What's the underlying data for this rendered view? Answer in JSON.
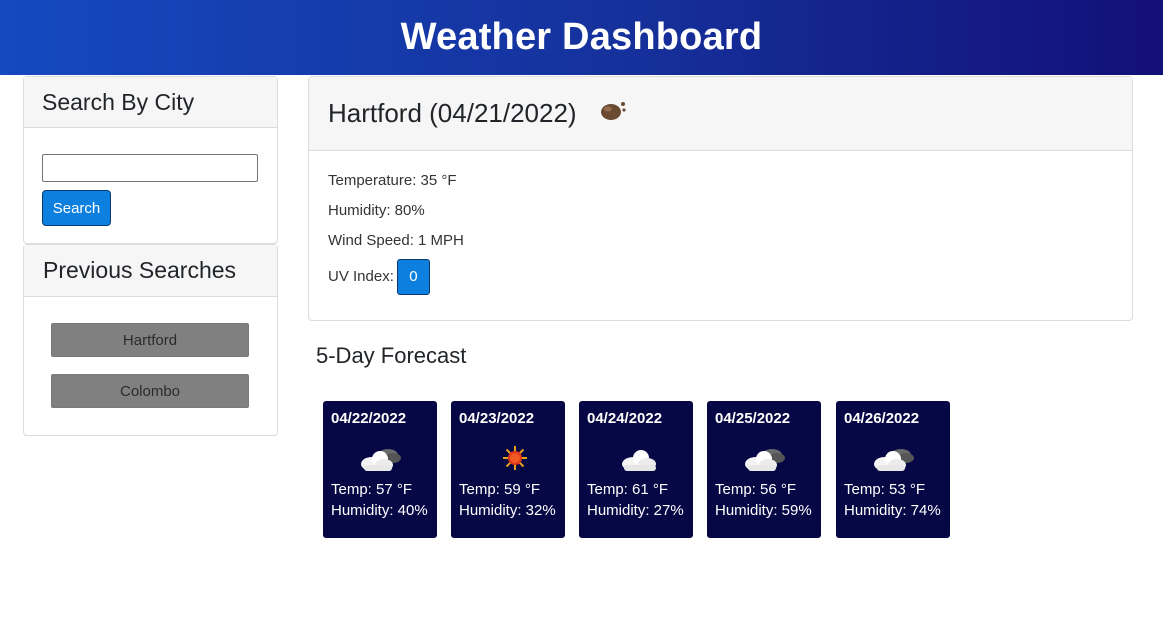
{
  "header": {
    "title": "Weather Dashboard"
  },
  "search": {
    "heading": "Search By City",
    "input_value": "",
    "button_label": "Search"
  },
  "history": {
    "heading": "Previous Searches",
    "items": [
      "Hartford",
      "Colombo"
    ]
  },
  "current": {
    "title": "Hartford (04/21/2022)",
    "icon": "haze-icon",
    "temperature": "Temperature: 35 °F",
    "humidity": "Humidity: 80%",
    "wind": "Wind Speed: 1 MPH",
    "uv_label": "UV Index:",
    "uv_value": "0",
    "uv_color": "#0d80df"
  },
  "forecast": {
    "heading": "5-Day Forecast",
    "days": [
      {
        "date": "04/22/2022",
        "icon": "partly-cloudy-icon",
        "temp": "Temp: 57 °F",
        "humidity": "Humidity: 40%"
      },
      {
        "date": "04/23/2022",
        "icon": "sun-icon",
        "temp": "Temp: 59 °F",
        "humidity": "Humidity: 32%"
      },
      {
        "date": "04/24/2022",
        "icon": "cloud-icon",
        "temp": "Temp: 61 °F",
        "humidity": "Humidity: 27%"
      },
      {
        "date": "04/25/2022",
        "icon": "partly-cloudy-icon",
        "temp": "Temp: 56 °F",
        "humidity": "Humidity: 59%"
      },
      {
        "date": "04/26/2022",
        "icon": "partly-cloudy-icon",
        "temp": "Temp: 53 °F",
        "humidity": "Humidity: 74%"
      }
    ]
  },
  "colors": {
    "header_start": "#1549c0",
    "header_end": "#130f78",
    "accent": "#0d80df",
    "forecast_card": "#060745",
    "history_button": "#808080"
  }
}
